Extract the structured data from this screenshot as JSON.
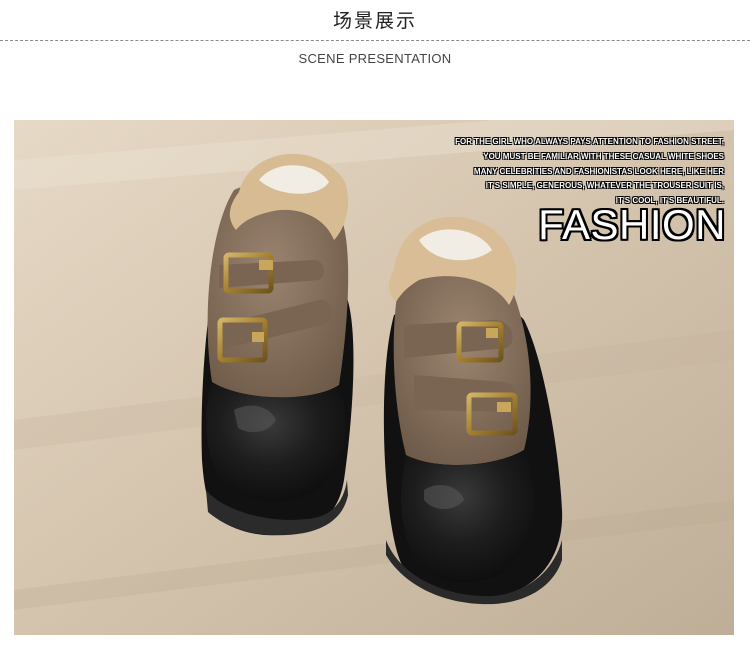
{
  "header": {
    "title": "场景展示",
    "subtitle": "SCENE PRESENTATION"
  },
  "photo": {
    "tagline_lines": [
      "FOR THE GIRL WHO ALWAYS PAYS ATTENTION TO FASHION STREET,",
      "YOU MUST BE FAMILIAR WITH THESE CASUAL WHITE SHOES",
      "MANY CELEBRITIES AND FASHIONISTAS LOOK HERE, LIKE HER",
      "IT'S SIMPLE, GENEROUS, WHATEVER THE TROUSER SUIT IS,",
      "IT'S COOL, IT'S BEAUTIFUL."
    ],
    "headline": "FASHION"
  },
  "colors": {
    "suede": "#8a7461",
    "fleece": "#d9bd96",
    "toe_cap": "#1c1c1c",
    "sole": "#141414",
    "buckle": "#b08a3e",
    "floor": "#cfc0ad"
  }
}
